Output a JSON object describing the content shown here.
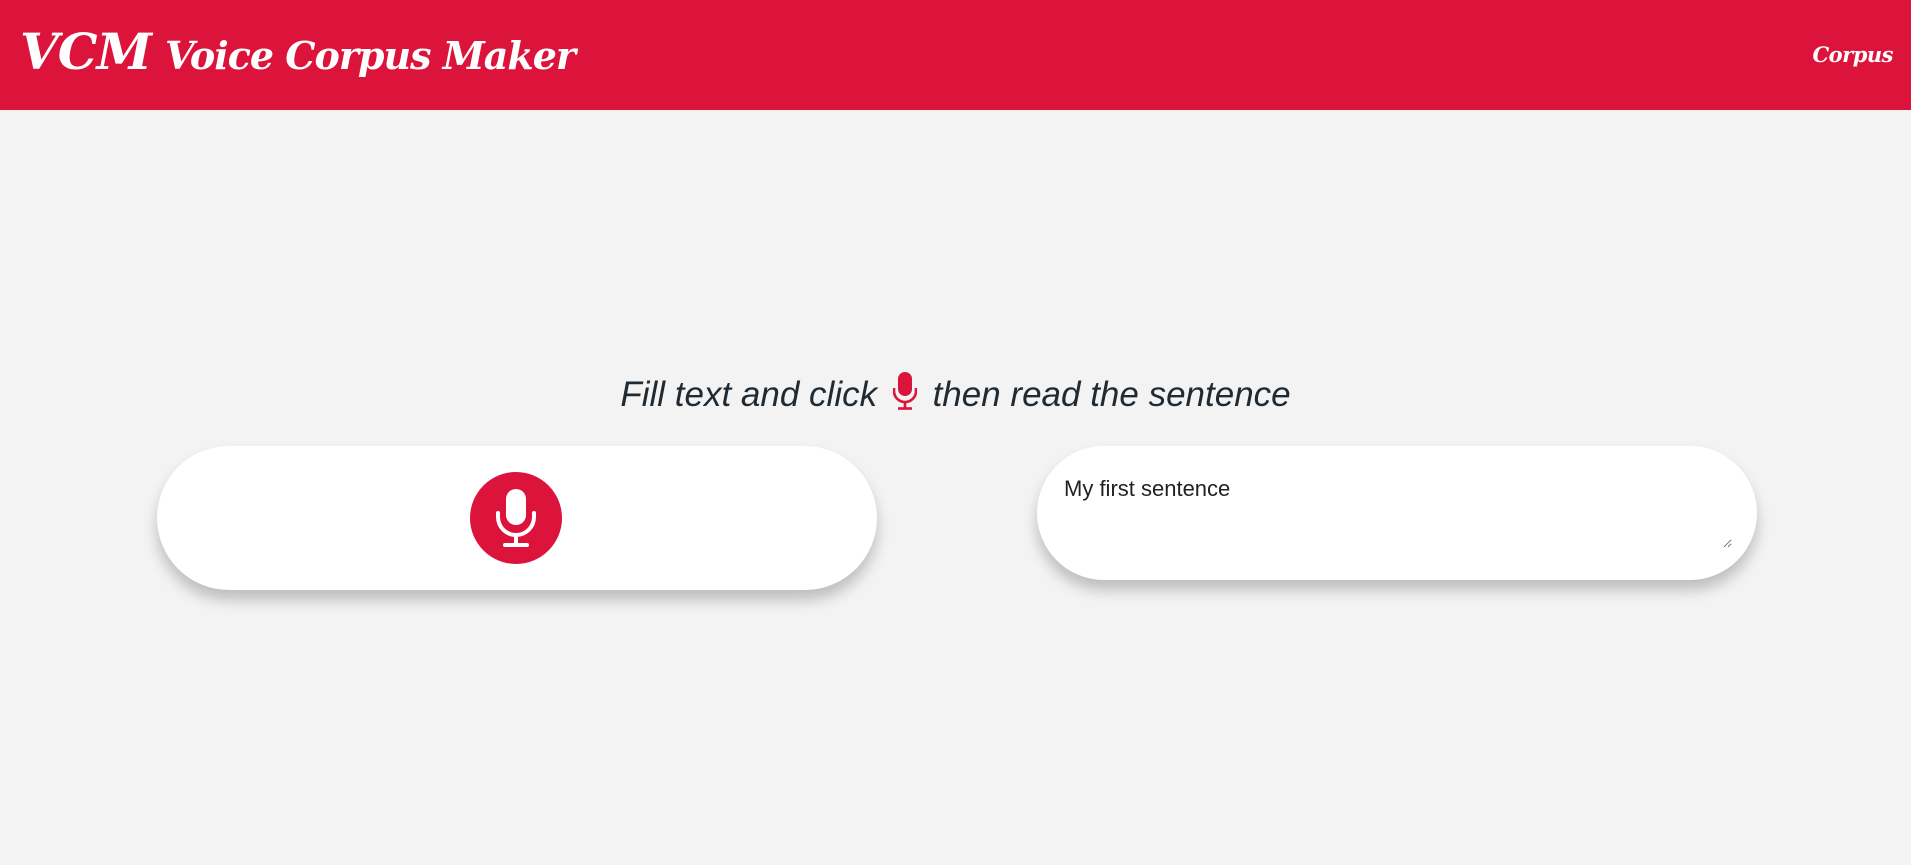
{
  "navbar": {
    "brand_abbr": "VCM",
    "brand_name": "Voice Corpus Maker",
    "link_corpus": "Corpus",
    "background_color": "#dc143c"
  },
  "instruction": {
    "before_icon": "Fill text and click",
    "icon": "microphone-icon",
    "after_icon": "then read the sentence"
  },
  "recorder": {
    "icon": "microphone-icon",
    "accent_color": "#dc143c"
  },
  "sentence": {
    "value": "My first sentence"
  }
}
